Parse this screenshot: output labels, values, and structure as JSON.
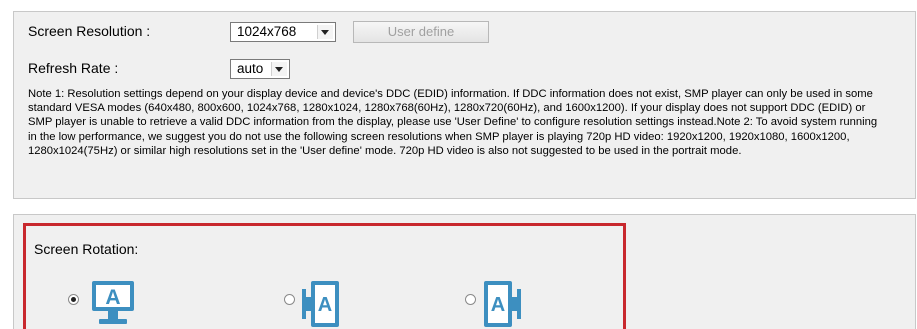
{
  "resolution": {
    "label": "Screen Resolution :",
    "selected": "1024x768",
    "user_define_button": "User define"
  },
  "refresh": {
    "label": "Refresh Rate :",
    "selected": "auto"
  },
  "note_text": "Note 1: Resolution settings depend on your display device and device's DDC (EDID) information. If DDC information does not exist, SMP player can only be used in some standard VESA modes (640x480, 800x600, 1024x768, 1280x1024, 1280x768(60Hz), 1280x720(60Hz), and 1600x1200). If your display does not support DDC (EDID) or SMP player is unable to retrieve a valid DDC information from the display, please use 'User Define' to configure resolution settings instead.Note 2: To avoid system running in the low performance, we suggest you do not use the following screen resolutions when SMP player is playing 720p HD video: 1920x1200, 1920x1080, 1600x1200, 1280x1024(75Hz) or similar high resolutions set in the 'User define' mode. 720p HD video is also not suggested to be used in the portrait mode.",
  "rotation": {
    "label": "Screen Rotation:",
    "icon_letter": "A",
    "options": [
      {
        "icon": "landscape-monitor-icon",
        "checked": true
      },
      {
        "icon": "portrait-left-icon",
        "checked": false
      },
      {
        "icon": "portrait-right-icon",
        "checked": false
      }
    ]
  },
  "colors": {
    "highlight": "#c8282d",
    "icon": "#3d8fc0"
  }
}
